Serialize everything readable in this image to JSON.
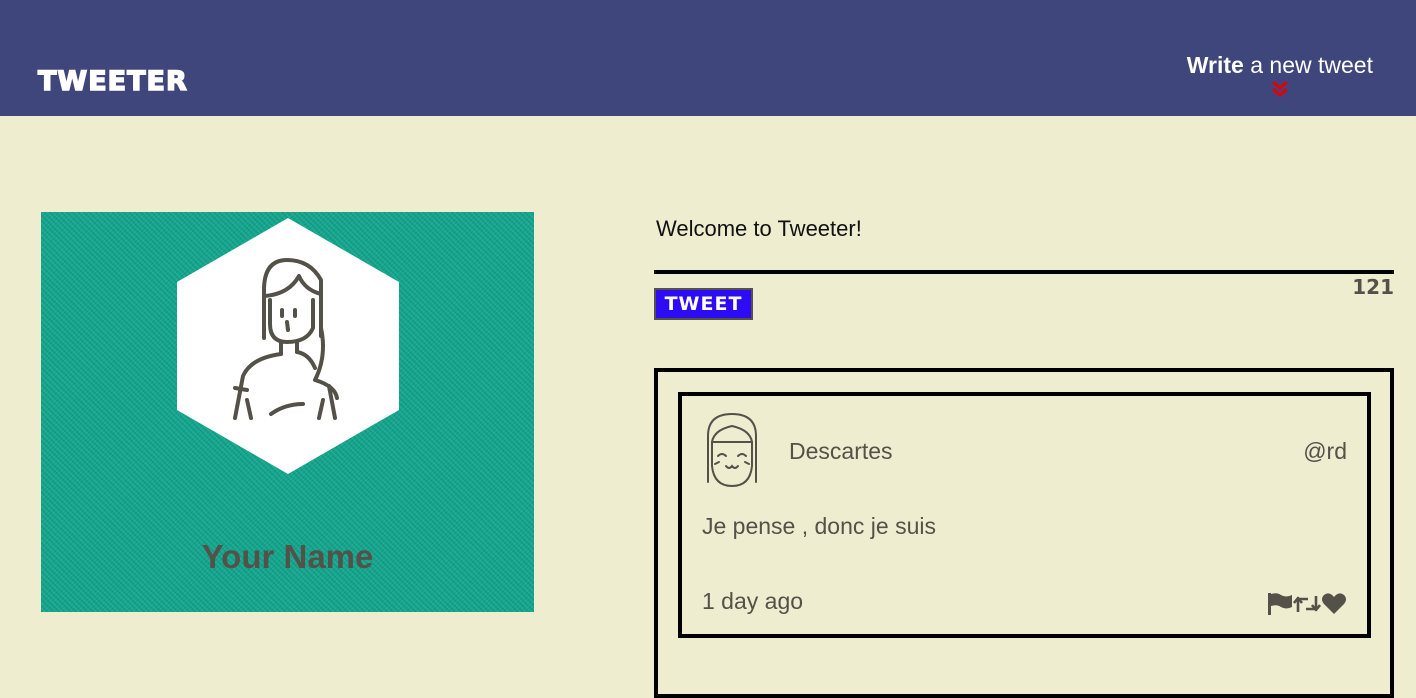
{
  "app": {
    "brand": "Tweeter",
    "compose_strong": "Write",
    "compose_rest": " a new tweet",
    "compose_icon": "double-chevron-down-icon",
    "accent": "#3f467b",
    "background": "#eeedd0"
  },
  "profile": {
    "name": "Your Name",
    "avatar_icon": "person-avatar-icon",
    "card_color": "#11a68d"
  },
  "composer": {
    "placeholder": "Welcome to Tweeter!",
    "button_label": "TWEET",
    "button_color": "#2e0bf5",
    "char_counter": "121"
  },
  "feed": {
    "tweets": [
      {
        "author": "Descartes",
        "handle": "@rd",
        "content": "Je pense , donc je suis",
        "time": "1 day ago",
        "avatar_icon": "smiling-face-avatar-icon",
        "actions": [
          "flag-icon",
          "retweet-icon",
          "heart-icon"
        ]
      }
    ]
  }
}
